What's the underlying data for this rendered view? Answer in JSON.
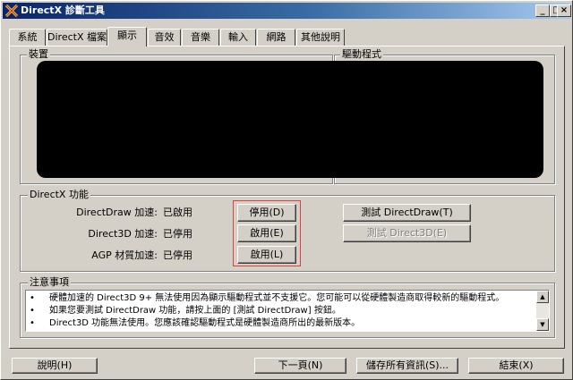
{
  "window": {
    "title": "DirectX 診斷工具"
  },
  "titlebar_buttons": {
    "minimize": "_",
    "maximize": "□",
    "close": "×"
  },
  "tabs": [
    {
      "label": "系統"
    },
    {
      "label": "DirectX 檔案"
    },
    {
      "label": "顯示"
    },
    {
      "label": "音效"
    },
    {
      "label": "音樂"
    },
    {
      "label": "輸入"
    },
    {
      "label": "網路"
    },
    {
      "label": "其他說明"
    }
  ],
  "display": {
    "device_group": "裝置",
    "driver_group": "驅動程式"
  },
  "features": {
    "group_label": "DirectX 功能",
    "rows": [
      {
        "label": "DirectDraw 加速:",
        "status": "已啟用",
        "toggle": "停用(D)",
        "test": "測試 DirectDraw(T)",
        "test_enabled": true
      },
      {
        "label": "Direct3D 加速:",
        "status": "已停用",
        "toggle": "啟用(E)",
        "test": "測試 Direct3D(E)",
        "test_enabled": false
      },
      {
        "label": "AGP 材質加速:",
        "status": "已停用",
        "toggle": "啟用(L)"
      }
    ]
  },
  "notes": {
    "group_label": "注意事項",
    "items": [
      "硬體加速的 Direct3D 9+ 無法使用因為顯示驅動程式並不支援它。您可能可以從硬體製造商取得較新的驅動程式。",
      "如果您要測試 DirectDraw 功能，請按上面的 [測試 DirectDraw] 按鈕。",
      "Direct3D 功能無法使用。您應該確認驅動程式是硬體製造商所出的最新版本。"
    ]
  },
  "bottom": {
    "help": "說明(H)",
    "next": "下一頁(N)",
    "save": "儲存所有資訊(S)...",
    "exit": "結束(X)"
  }
}
